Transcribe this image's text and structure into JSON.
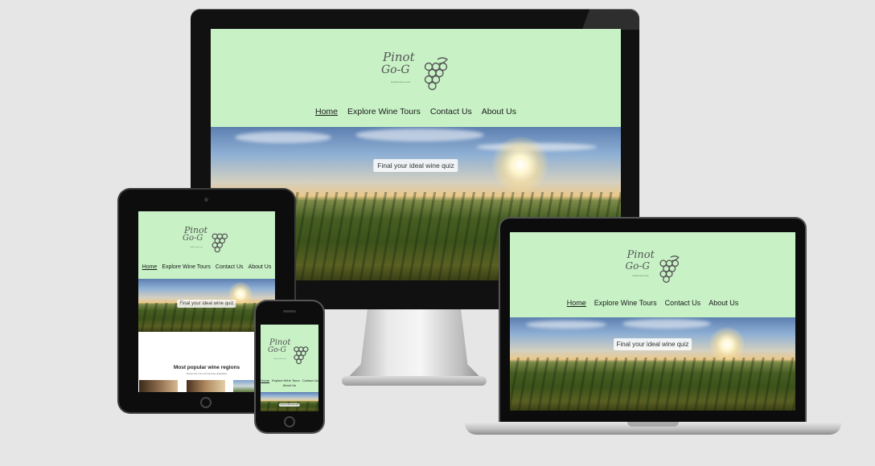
{
  "site": {
    "logo_line1": "Pinot",
    "logo_line2": "Go-G",
    "logo_tagline": "Guided wine tours",
    "nav": [
      "Home",
      "Explore Wine Tours",
      "Contact Us",
      "About Us"
    ],
    "hero_button": "Final your ideal wine quiz"
  },
  "tablet": {
    "section_title": "Most popular wine regions",
    "section_subtitle": "Choose from one of our top three destinations"
  },
  "colors": {
    "header_bg": "#c8f2c6",
    "page_bg": "#e6e6e6",
    "device_frame": "#0d0d0d"
  }
}
